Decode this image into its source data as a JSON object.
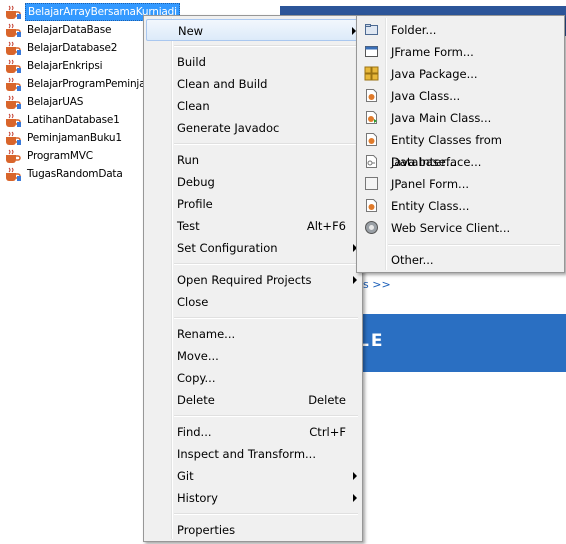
{
  "tree": {
    "projects": [
      {
        "label": "BelajarArrayBersamaKurniadi",
        "selected": true
      },
      {
        "label": "BelajarDataBase",
        "selected": false
      },
      {
        "label": "BelajarDatabase2",
        "selected": false
      },
      {
        "label": "BelajarEnkripsi",
        "selected": false
      },
      {
        "label": "BelajarProgramPeminjam",
        "selected": false
      },
      {
        "label": "BelajarUAS",
        "selected": false
      },
      {
        "label": "LatihanDatabase1",
        "selected": false
      },
      {
        "label": "PeminjamanBuku1",
        "selected": false
      },
      {
        "label": "ProgramMVC",
        "selected": false
      },
      {
        "label": "TugasRandomData",
        "selected": false
      }
    ]
  },
  "background": {
    "link_text": "ws >>",
    "logo_text": "LE"
  },
  "context_menu": {
    "new": "New",
    "build": "Build",
    "clean_and_build": "Clean and Build",
    "clean": "Clean",
    "generate_javadoc": "Generate Javadoc",
    "run": "Run",
    "debug": "Debug",
    "profile": "Profile",
    "test": "Test",
    "test_accel": "Alt+F6",
    "set_configuration": "Set Configuration",
    "open_required_projects": "Open Required Projects",
    "close": "Close",
    "rename": "Rename...",
    "move": "Move...",
    "copy": "Copy...",
    "delete": "Delete",
    "delete_accel": "Delete",
    "find": "Find...",
    "find_accel": "Ctrl+F",
    "inspect_and_transform": "Inspect and Transform...",
    "git": "Git",
    "history": "History",
    "properties": "Properties"
  },
  "new_submenu": {
    "folder": "Folder...",
    "jframe_form": "JFrame Form...",
    "java_package": "Java Package...",
    "java_class": "Java Class...",
    "java_main_class": "Java Main Class...",
    "entity_classes_from_database": "Entity Classes from Database...",
    "java_interface": "Java Interface...",
    "jpanel_form": "JPanel Form...",
    "entity_class": "Entity Class...",
    "web_service_client": "Web Service Client...",
    "other": "Other..."
  },
  "colors": {
    "selection": "#3399ff",
    "menu_bg": "#f0f0f0",
    "hover_border": "#a9c7ef",
    "page_accent": "#2a6fc2"
  }
}
